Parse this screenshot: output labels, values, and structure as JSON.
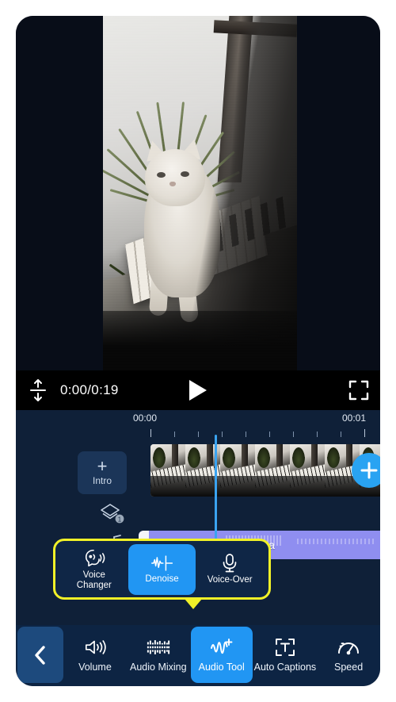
{
  "app": {
    "name": "mobile-video-editor"
  },
  "preview": {
    "description": "white cat walking on piano keys near window with plant"
  },
  "player": {
    "fit_icon": "fit-arrows-icon",
    "time": "0:00/0:19",
    "play_icon": "play-icon",
    "fullscreen_icon": "fullscreen-icon"
  },
  "timeline": {
    "ruler_labels": [
      "00:00",
      "00:01"
    ],
    "intro": {
      "plus": "+",
      "label": "Intro"
    },
    "add_track_icon": "plus-icon",
    "layers_icon": "layers-icon",
    "note_icon": "music-note-icon",
    "audio_clip": {
      "name": "credit card slam.m4a",
      "icon": "audio-file-icon",
      "color": "#8f8ef0"
    },
    "playhead_color": "#3aa3f0"
  },
  "popup": {
    "border_color": "#f1f128",
    "active_color": "#2196f3",
    "items": [
      {
        "label": "Voice\nChanger",
        "label_line1": "Voice",
        "label_line2": "Changer",
        "icon": "voice-changer-icon",
        "active": false
      },
      {
        "label": "Denoise",
        "icon": "denoise-waveform-icon",
        "active": true
      },
      {
        "label": "Voice-Over",
        "icon": "microphone-icon",
        "active": false
      }
    ]
  },
  "toolbar": {
    "back_icon": "chevron-left-icon",
    "active_color": "#2196f3",
    "items": [
      {
        "label": "Volume",
        "icon": "speaker-icon",
        "active": false
      },
      {
        "label": "Audio Mixing",
        "icon": "equalizer-icon",
        "active": false
      },
      {
        "label": "Audio Tool",
        "icon": "audio-tool-waveform-icon",
        "active": true
      },
      {
        "label": "Auto Captions",
        "icon": "text-frame-icon",
        "active": false
      },
      {
        "label": "Speed",
        "icon": "speedometer-icon",
        "active": false
      }
    ]
  }
}
